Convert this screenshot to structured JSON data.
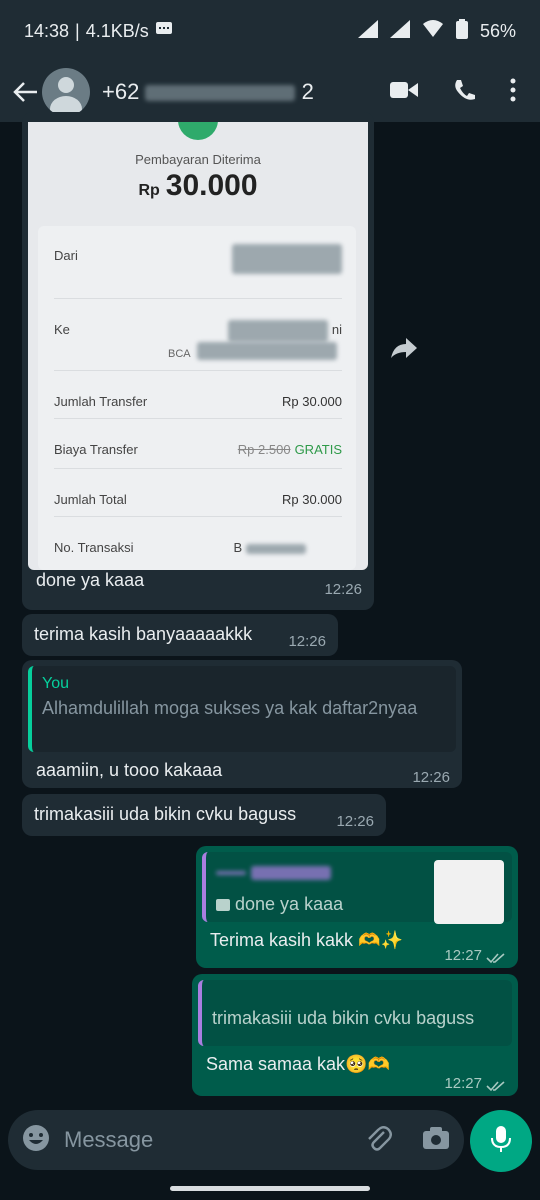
{
  "status": {
    "time": "14:38",
    "speed": "4.1KB/s",
    "battery": "56%"
  },
  "header": {
    "contact_prefix": "+62",
    "contact_suffix": "2"
  },
  "receipt": {
    "heading": "Pembayaran Diterima",
    "currency": "Rp",
    "amount": "30.000",
    "rows": [
      {
        "label": "Dari",
        "value": ""
      },
      {
        "label": "Ke",
        "value": "ni"
      },
      {
        "label": "Jumlah Transfer",
        "value": "Rp 30.000"
      },
      {
        "label": "Biaya Transfer",
        "value_strike": "Rp 2.500",
        "value_green": "GRATIS"
      },
      {
        "label": "Jumlah Total",
        "value": "Rp 30.000"
      },
      {
        "label": "No. Transaksi",
        "value": "B"
      }
    ],
    "bank_prefix": "BCA"
  },
  "messages": [
    {
      "text": "done ya kaaa",
      "time": "12:26"
    },
    {
      "text": "terima kasih banyaaaaakkk",
      "time": "12:26"
    },
    {
      "quote_name": "You",
      "quote_text": "Alhamdulillah moga sukses ya kak daftar2nyaa",
      "text": "aaamiin, u tooo kakaaa",
      "time": "12:26"
    },
    {
      "text": "trimakasiii uda bikin cvku baguss",
      "time": "12:26"
    },
    {
      "quote_text": "done ya kaaa",
      "text": "Terima kasih kakk 🫶✨",
      "time": "12:27"
    },
    {
      "quote_text": "trimakasiii uda bikin cvku baguss",
      "text": "Sama samaa kak🥺🫶",
      "time": "12:27"
    }
  ],
  "input": {
    "placeholder": "Message"
  },
  "colors": {
    "incoming": "#1f2c34",
    "outgoing": "#005c4b",
    "accent": "#00a884"
  }
}
